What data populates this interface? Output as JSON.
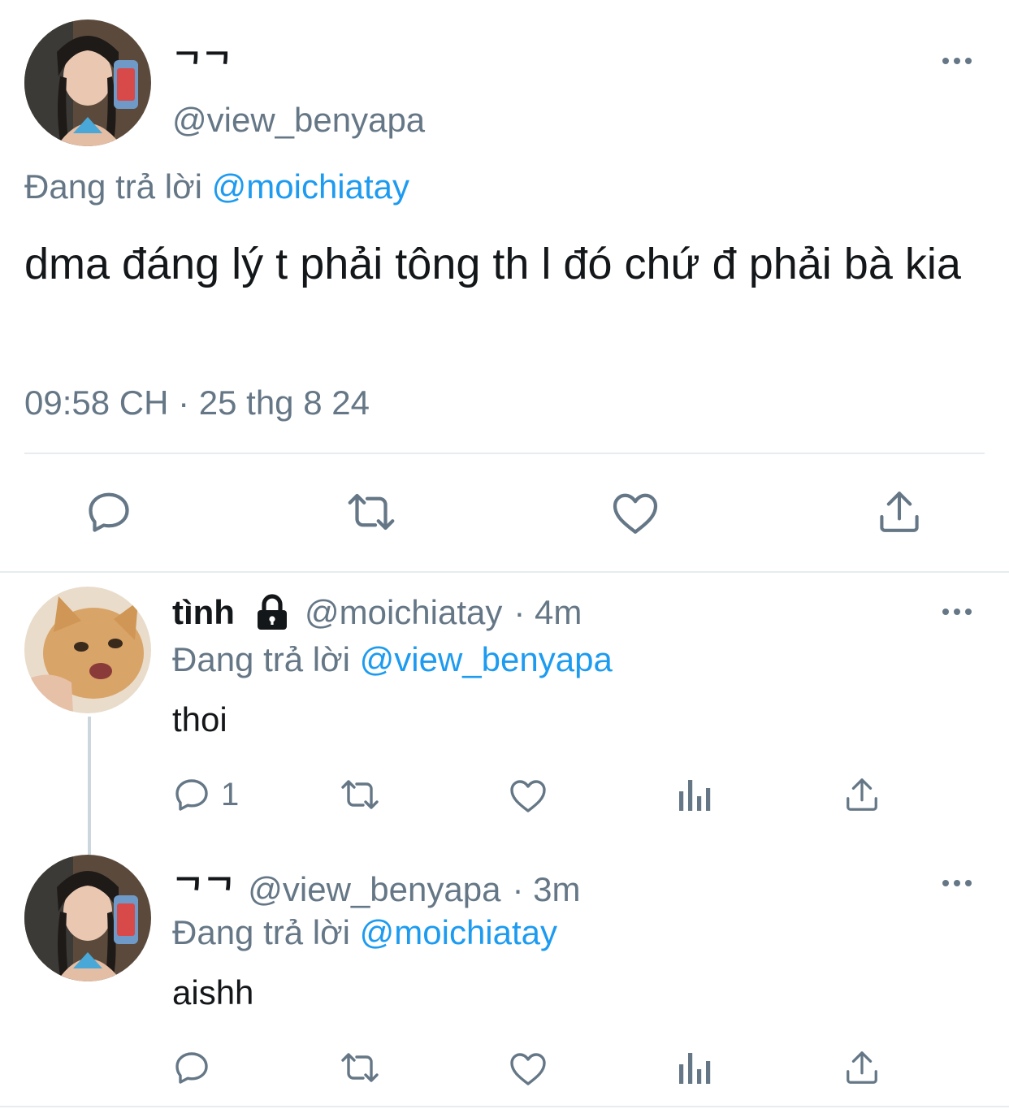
{
  "main_tweet": {
    "display_name": "ᄀᄀ",
    "handle": "@view_benyapa",
    "reply_prefix": "Đang trả lời",
    "reply_to": "@moichiatay",
    "text": "dma đáng lý t phải tông th l đó chứ đ phải bà kia",
    "timestamp": "09:58 CH · 25 thg 8 24"
  },
  "replies": [
    {
      "display_name": "tình",
      "handle": "@moichiatay",
      "time": "· 4m",
      "reply_prefix": "Đang trả lời",
      "reply_to": "@view_benyapa",
      "text": "thoi",
      "reply_count": "1",
      "protected": true
    },
    {
      "display_name": "ᄀᄀ",
      "handle": "@view_benyapa",
      "time": "· 3m",
      "reply_prefix": "Đang trả lời",
      "reply_to": "@moichiatay",
      "text": "aishh",
      "protected": false
    }
  ],
  "icons": {
    "reply": "reply-icon",
    "retweet": "retweet-icon",
    "like": "like-icon",
    "share": "share-icon",
    "views": "analytics-icon",
    "more": "more-icon",
    "lock": "lock-icon"
  },
  "colors": {
    "link": "#1d9bf0",
    "muted": "#657786",
    "text": "#14171a"
  }
}
